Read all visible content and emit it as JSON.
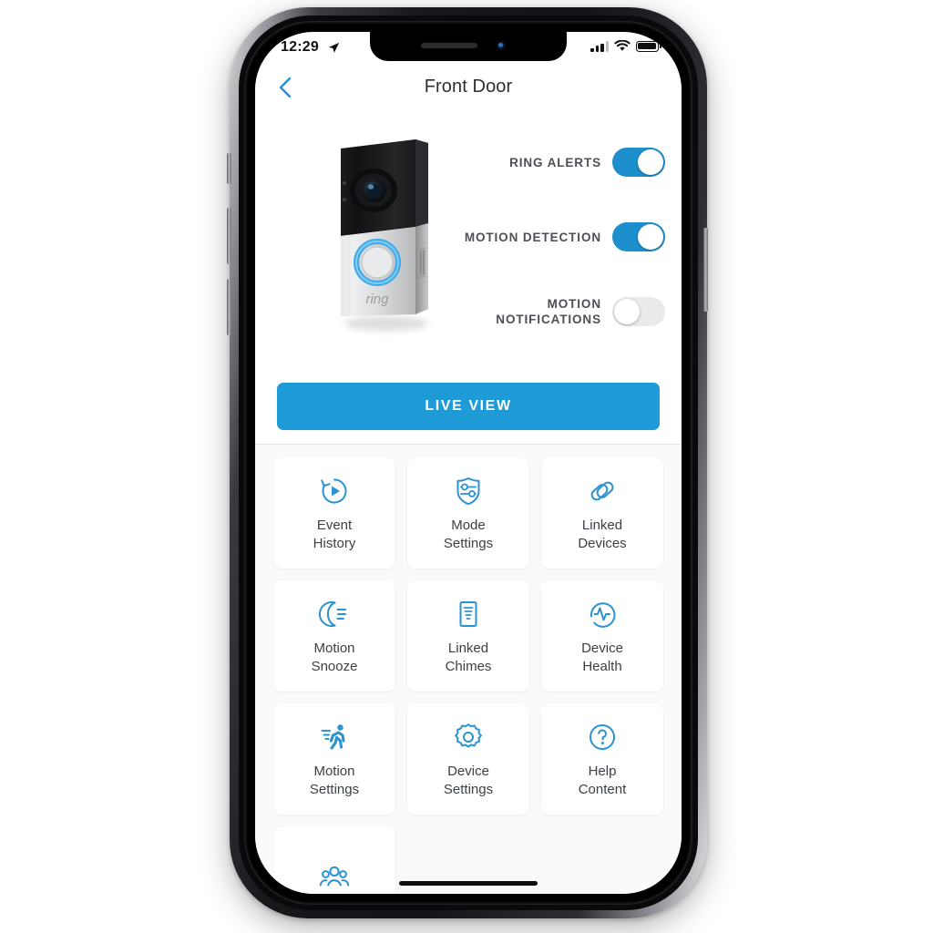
{
  "status_bar": {
    "time": "12:29",
    "location_icon": "location-arrow-icon",
    "signal_icon": "cellular-signal-icon",
    "wifi_icon": "wifi-icon",
    "battery_icon": "battery-full-icon"
  },
  "nav": {
    "back_icon": "chevron-left-icon",
    "title": "Front Door"
  },
  "device": {
    "image_name": "ring-video-doorbell-photo",
    "brand_text": "ring"
  },
  "toggles": [
    {
      "label": "RING\nALERTS",
      "state": "on",
      "name": "ring-alerts-toggle"
    },
    {
      "label": "MOTION\nDETECTION",
      "state": "on",
      "name": "motion-detection-toggle"
    },
    {
      "label": "MOTION\nNOTIFICATIONS",
      "state": "off",
      "name": "motion-notifications-toggle"
    }
  ],
  "live_view": {
    "label": "LIVE VIEW"
  },
  "grid": [
    {
      "label": "Event\nHistory",
      "icon": "event-history-icon"
    },
    {
      "label": "Mode\nSettings",
      "icon": "mode-settings-shield-icon"
    },
    {
      "label": "Linked\nDevices",
      "icon": "linked-devices-chain-icon"
    },
    {
      "label": "Motion\nSnooze",
      "icon": "motion-snooze-moon-icon"
    },
    {
      "label": "Linked\nChimes",
      "icon": "linked-chimes-document-icon"
    },
    {
      "label": "Device\nHealth",
      "icon": "device-health-pulse-icon"
    },
    {
      "label": "Motion\nSettings",
      "icon": "motion-settings-runner-icon"
    },
    {
      "label": "Device\nSettings",
      "icon": "device-settings-gear-icon"
    },
    {
      "label": "Help\nContent",
      "icon": "help-content-question-icon"
    },
    {
      "label": "",
      "icon": "shared-users-people-icon"
    }
  ],
  "colors": {
    "accent_blue": "#1e9bd7",
    "toggle_on": "#1e8fcd",
    "toggle_off": "#e9eaeb",
    "icon_blue": "#2b93d0",
    "text_dark": "#3b4045",
    "grid_bg": "#fafafa"
  }
}
